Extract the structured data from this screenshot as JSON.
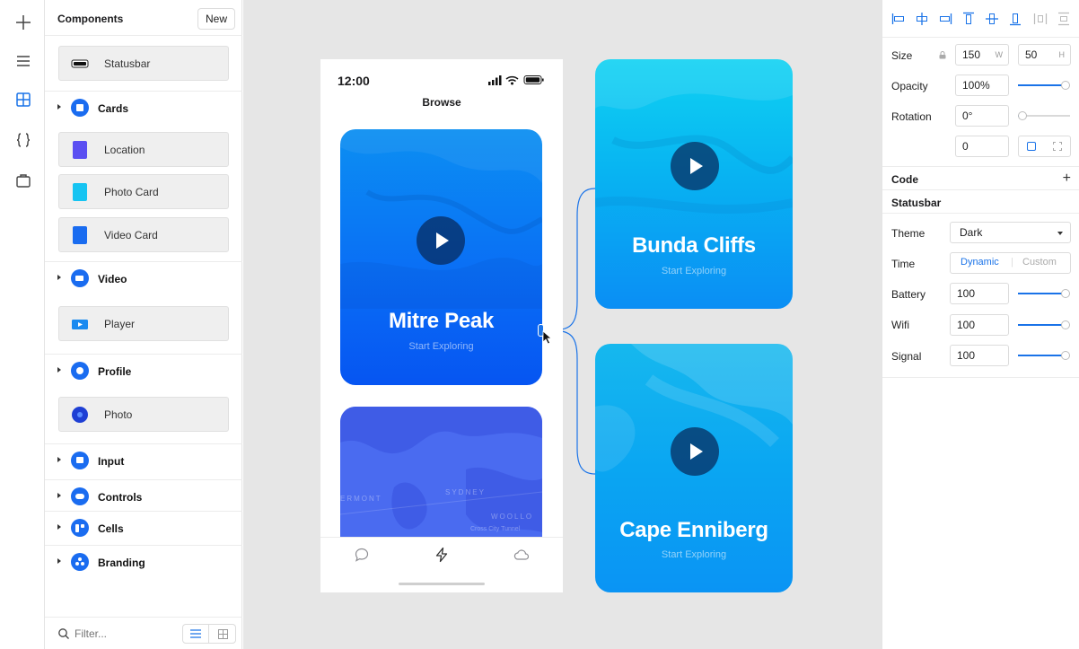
{
  "components_panel": {
    "title": "Components",
    "new_label": "New",
    "items_top": [
      {
        "label": "Statusbar"
      }
    ],
    "groups": [
      {
        "label": "Cards",
        "items": [
          "Location",
          "Photo Card",
          "Video Card"
        ]
      },
      {
        "label": "Video",
        "items": [
          "Player"
        ]
      },
      {
        "label": "Profile",
        "items": [
          "Photo"
        ]
      },
      {
        "label": "Input",
        "items": []
      },
      {
        "label": "Controls",
        "items": []
      },
      {
        "label": "Cells",
        "items": []
      },
      {
        "label": "Branding",
        "items": []
      }
    ],
    "filter_placeholder": "Filter..."
  },
  "phone": {
    "time": "12:00",
    "screen_title": "Browse",
    "card_main": {
      "title": "Mitre Peak",
      "subtitle": "Start Exploring"
    },
    "map_labels": [
      "ERMONT",
      "SYDNEY",
      "WOOLLO",
      "Cross City Tunnel"
    ]
  },
  "canvas_cards": [
    {
      "title": "Bunda Cliffs",
      "subtitle": "Start Exploring"
    },
    {
      "title": "Cape Enniberg",
      "subtitle": "Start Exploring"
    }
  ],
  "inspector": {
    "size_label": "Size",
    "width": "150",
    "width_suffix": "W",
    "height": "50",
    "height_suffix": "H",
    "opacity_label": "Opacity",
    "opacity": "100%",
    "opacity_level": 1.0,
    "rotation_label": "Rotation",
    "rotation": "0°",
    "rotation_level": 0.0,
    "radius": "0",
    "code_label": "Code",
    "statusbar_label": "Statusbar",
    "theme_label": "Theme",
    "theme_value": "Dark",
    "time_label": "Time",
    "time_options": [
      "Dynamic",
      "Custom"
    ],
    "time_selected": "Dynamic",
    "battery_label": "Battery",
    "battery": "100",
    "wifi_label": "Wifi",
    "wifi": "100",
    "signal_label": "Signal",
    "signal": "100"
  },
  "colors": {
    "accent": "#1a73e8",
    "card_blue": "#0a6cf2",
    "card_cyan": "#08b6f2"
  }
}
